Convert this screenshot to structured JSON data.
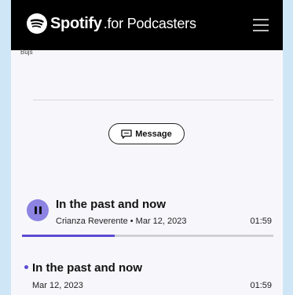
{
  "header": {
    "brand": "Spotify",
    "brand_suffix": ".for Podcasters",
    "menu_icon": "hamburger-icon"
  },
  "crumb": "Bujs",
  "message_button": {
    "label": "Message",
    "icon": "chat-bubble-icon"
  },
  "episodes": [
    {
      "title": "In the past and now",
      "meta": "Crianza Reverente • Mar 12, 2023",
      "duration": "01:59",
      "playing": true,
      "progress": 0.37
    },
    {
      "title": "In the past and now",
      "meta": "Mar 12, 2023",
      "duration": "01:59",
      "playing": false
    }
  ],
  "colors": {
    "accent": "#5b4bd1",
    "play_button": "#8c83e3",
    "topbar": "#000000"
  }
}
